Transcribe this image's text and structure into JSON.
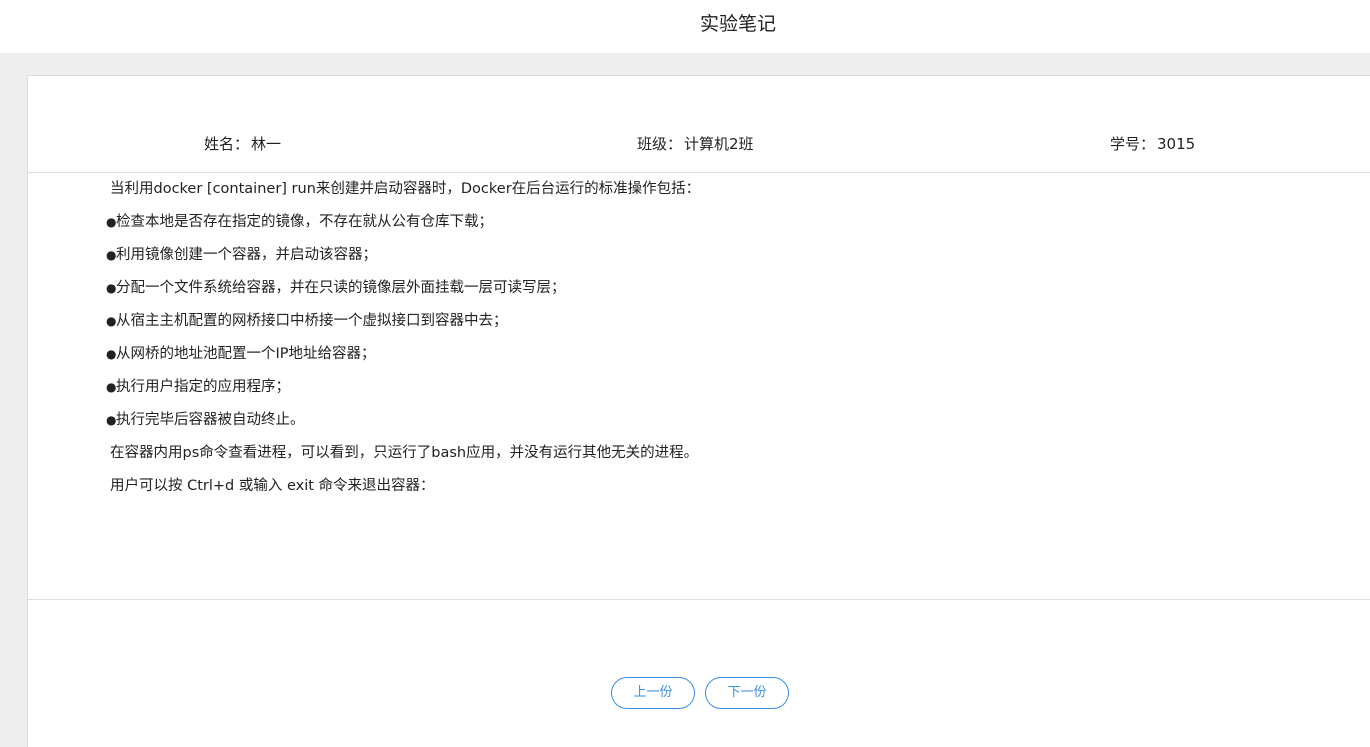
{
  "header": {
    "title": "实验笔记"
  },
  "student": {
    "name_label": "姓名：",
    "name_value": "林一",
    "class_label": "班级：",
    "class_value": "计算机2班",
    "id_label": "学号：",
    "id_value": "3015"
  },
  "note": {
    "intro": "当利用docker [container] run来创建并启动容器时，Docker在后台运行的标准操作包括：",
    "bullet_symbol": "●",
    "bullets": [
      "检查本地是否存在指定的镜像，不存在就从公有仓库下载；",
      "利用镜像创建一个容器，并启动该容器；",
      "分配一个文件系统给容器，并在只读的镜像层外面挂载一层可读写层；",
      "从宿主主机配置的网桥接口中桥接一个虚拟接口到容器中去；",
      "从网桥的地址池配置一个IP地址给容器；",
      "执行用户指定的应用程序；",
      "执行完毕后容器被自动终止。"
    ],
    "para1": "在容器内用ps命令查看进程，可以看到，只运行了bash应用，并没有运行其他无关的进程。",
    "para2": "用户可以按 Ctrl+d 或输入 exit 命令来退出容器："
  },
  "pager": {
    "prev_label": "上一份",
    "next_label": "下一份"
  },
  "colors": {
    "accent": "#3a8ee6",
    "page_bg": "#eeeeee",
    "card_bg": "#ffffff",
    "border": "#dddddd"
  }
}
